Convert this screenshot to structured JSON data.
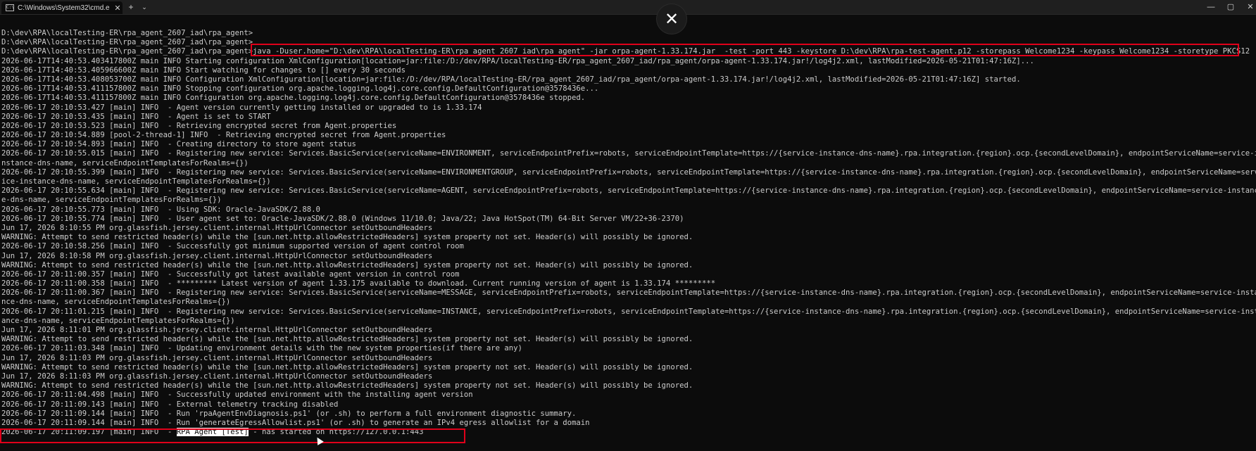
{
  "window": {
    "tab_title": "C:\\Windows\\System32\\cmd.e",
    "tab_close": "✕",
    "new_tab": "+",
    "tab_dropdown": "⌄",
    "minimize": "—",
    "maximize": "▢",
    "close": "✕",
    "overlay_close": "✕"
  },
  "console": {
    "lines": [
      "D:\\dev\\RPA\\localTesting-ER\\rpa_agent_2607_iad\\rpa_agent>",
      "D:\\dev\\RPA\\localTesting-ER\\rpa_agent_2607_iad\\rpa_agent>",
      "D:\\dev\\RPA\\localTesting-ER\\rpa_agent_2607_iad\\rpa_agent>java -Duser.home=\"D:\\dev\\RPA\\localTesting-ER\\rpa_agent_2607_iad\\rpa_agent\" -jar orpa-agent-1.33.174.jar  -test -port 443 -keystore D:\\dev\\RPA\\rpa-test-agent.p12 -storepass Welcome1234 -keypass Welcome1234 -storetype PKCS12",
      "2026-06-17T14:40:53.403417800Z main INFO Starting configuration XmlConfiguration[location=jar:file:/D:/dev/RPA/localTesting-ER/rpa_agent_2607_iad/rpa_agent/orpa-agent-1.33.174.jar!/log4j2.xml, lastModified=2026-05-21T01:47:16Z]...",
      "2026-06-17T14:40:53.405966600Z main INFO Start watching for changes to [] every 30 seconds",
      "2026-06-17T14:40:53.408053700Z main INFO Configuration XmlConfiguration[location=jar:file:/D:/dev/RPA/localTesting-ER/rpa_agent_2607_iad/rpa_agent/orpa-agent-1.33.174.jar!/log4j2.xml, lastModified=2026-05-21T01:47:16Z] started.",
      "2026-06-17T14:40:53.411157800Z main INFO Stopping configuration org.apache.logging.log4j.core.config.DefaultConfiguration@3578436e...",
      "2026-06-17T14:40:53.411157800Z main INFO Configuration org.apache.logging.log4j.core.config.DefaultConfiguration@3578436e stopped.",
      "2026-06-17 20:10:53.427 [main] INFO  - Agent version currently getting installed or upgraded to is 1.33.174",
      "2026-06-17 20:10:53.435 [main] INFO  - Agent is set to START",
      "2026-06-17 20:10:53.523 [main] INFO  - Retrieving encrypted secret from Agent.properties",
      "2026-06-17 20:10:54.889 [pool-2-thread-1] INFO  - Retrieving encrypted secret from Agent.properties",
      "2026-06-17 20:10:54.893 [main] INFO  - Creating directory to store agent status",
      "2026-06-17 20:10:55.015 [main] INFO  - Registering new service: Services.BasicService(serviceName=ENVIRONMENT, serviceEndpointPrefix=robots, serviceEndpointTemplate=https://{service-instance-dns-name}.rpa.integration.{region}.ocp.{secondLevelDomain}, endpointServiceName=service-i",
      "nstance-dns-name, serviceEndpointTemplatesForRealms={})",
      "2026-06-17 20:10:55.399 [main] INFO  - Registering new service: Services.BasicService(serviceName=ENVIRONMENTGROUP, serviceEndpointPrefix=robots, serviceEndpointTemplate=https://{service-instance-dns-name}.rpa.integration.{region}.ocp.{secondLevelDomain}, endpointServiceName=serv",
      "ice-instance-dns-name, serviceEndpointTemplatesForRealms={})",
      "2026-06-17 20:10:55.634 [main] INFO  - Registering new service: Services.BasicService(serviceName=AGENT, serviceEndpointPrefix=robots, serviceEndpointTemplate=https://{service-instance-dns-name}.rpa.integration.{region}.ocp.{secondLevelDomain}, endpointServiceName=service-instanc",
      "e-dns-name, serviceEndpointTemplatesForRealms={})",
      "2026-06-17 20:10:55.773 [main] INFO  - Using SDK: Oracle-JavaSDK/2.88.0",
      "2026-06-17 20:10:55.774 [main] INFO  - User agent set to: Oracle-JavaSDK/2.88.0 (Windows 11/10.0; Java/22; Java HotSpot(TM) 64-Bit Server VM/22+36-2370)",
      "Jun 17, 2026 8:10:55 PM org.glassfish.jersey.client.internal.HttpUrlConnector setOutboundHeaders",
      "WARNING: Attempt to send restricted header(s) while the [sun.net.http.allowRestrictedHeaders] system property not set. Header(s) will possibly be ignored.",
      "2026-06-17 20:10:58.256 [main] INFO  - Successfully got minimum supported version of agent control room",
      "Jun 17, 2026 8:10:58 PM org.glassfish.jersey.client.internal.HttpUrlConnector setOutboundHeaders",
      "WARNING: Attempt to send restricted header(s) while the [sun.net.http.allowRestrictedHeaders] system property not set. Header(s) will possibly be ignored.",
      "2026-06-17 20:11:00.357 [main] INFO  - Successfully got latest available agent version in control room",
      "2026-06-17 20:11:00.358 [main] INFO  - ********* Latest version of agent 1.33.175 available to download. Current running version of agent is 1.33.174 *********",
      "2026-06-17 20:11:00.367 [main] INFO  - Registering new service: Services.BasicService(serviceName=MESSAGE, serviceEndpointPrefix=robots, serviceEndpointTemplate=https://{service-instance-dns-name}.rpa.integration.{region}.ocp.{secondLevelDomain}, endpointServiceName=service-insta",
      "nce-dns-name, serviceEndpointTemplatesForRealms={})",
      "2026-06-17 20:11:01.215 [main] INFO  - Registering new service: Services.BasicService(serviceName=INSTANCE, serviceEndpointPrefix=robots, serviceEndpointTemplate=https://{service-instance-dns-name}.rpa.integration.{region}.ocp.{secondLevelDomain}, endpointServiceName=service-inst",
      "ance-dns-name, serviceEndpointTemplatesForRealms={})",
      "Jun 17, 2026 8:11:01 PM org.glassfish.jersey.client.internal.HttpUrlConnector setOutboundHeaders",
      "WARNING: Attempt to send restricted header(s) while the [sun.net.http.allowRestrictedHeaders] system property not set. Header(s) will possibly be ignored.",
      "2026-06-17 20:11:03.348 [main] INFO  - Updating environment details with the new system properties(if there are any)",
      "Jun 17, 2026 8:11:03 PM org.glassfish.jersey.client.internal.HttpUrlConnector setOutboundHeaders",
      "WARNING: Attempt to send restricted header(s) while the [sun.net.http.allowRestrictedHeaders] system property not set. Header(s) will possibly be ignored.",
      "Jun 17, 2026 8:11:03 PM org.glassfish.jersey.client.internal.HttpUrlConnector setOutboundHeaders",
      "WARNING: Attempt to send restricted header(s) while the [sun.net.http.allowRestrictedHeaders] system property not set. Header(s) will possibly be ignored.",
      "2026-06-17 20:11:04.498 [main] INFO  - Successfully updated environment with the installing agent version",
      "2026-06-17 20:11:09.143 [main] INFO  - External telemetry tracking disabled",
      "2026-06-17 20:11:09.144 [main] INFO  - Run 'rpaAgentEnvDiagnosis.ps1' (or .sh) to perform a full environment diagnostic summary.",
      "2026-06-17 20:11:09.144 [main] INFO  - Run 'generateEgressAllowlist.ps1' (or .sh) to generate an IPv4 egress allowlist for a domain"
    ],
    "last_line": {
      "prefix": "2026-06-17 20:11:09.197 [main] INFO  - ",
      "selected": "RPA Agent [Test]",
      "suffix": " - has started on https://127.0.0.1:443"
    }
  }
}
